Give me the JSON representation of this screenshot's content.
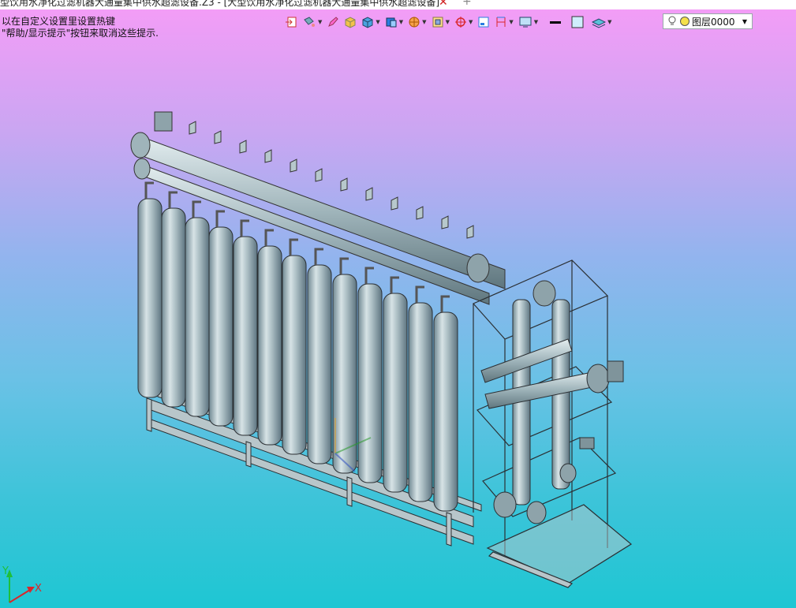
{
  "window": {
    "tab_title": "型饮用水净化过滤机器大通量集中供水超滤设备.Z3 - [大型饮用水净化过滤机器大通量集中供水超滤设备]",
    "close_symbol": "✕",
    "add_symbol": "+"
  },
  "hint": {
    "line1": "以在自定义设置里设置热键",
    "line2": "\"帮助/显示提示\"按钮来取消这些提示."
  },
  "toolbar": {
    "buttons": [
      {
        "icon": "exit-sketch-icon"
      },
      {
        "icon": "paint-bucket-icon"
      },
      {
        "icon": "pencil-icon"
      },
      {
        "icon": "solid-box-icon"
      },
      {
        "icon": "shaded-cube-icon"
      },
      {
        "icon": "blue-cube-icon"
      },
      {
        "icon": "orange-sphere-icon"
      },
      {
        "icon": "view-frame-icon"
      },
      {
        "icon": "target-icon"
      },
      {
        "icon": "window-icon"
      },
      {
        "icon": "dimension-icon"
      },
      {
        "icon": "monitor-icon"
      },
      {
        "icon": "line-weight-icon"
      },
      {
        "icon": "color-swatch-icon"
      },
      {
        "icon": "layers-icon"
      }
    ],
    "accent_blue": "#2a7de1",
    "accent_red": "#d9262b"
  },
  "layer": {
    "value": "图层0000"
  },
  "axes": {
    "x_label": "X",
    "y_label": "Y"
  },
  "scene": {
    "model": "ultrafiltration-unit",
    "membrane_count": 13
  }
}
